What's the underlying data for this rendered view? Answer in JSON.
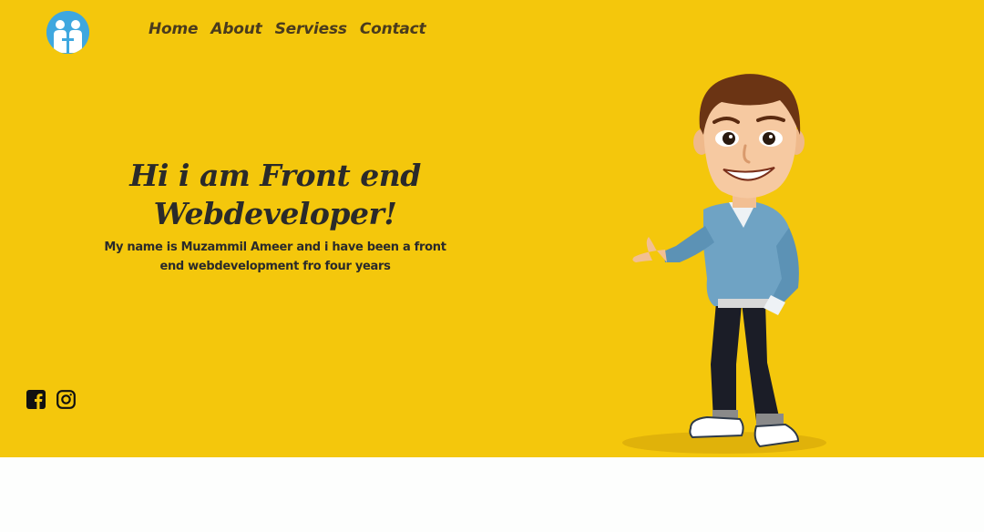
{
  "nav": {
    "items": [
      {
        "label": "Home"
      },
      {
        "label": "About"
      },
      {
        "label": "Serviess"
      },
      {
        "label": "Contact"
      }
    ]
  },
  "hero": {
    "headline": "Hi i am Front end Webdeveloper!",
    "subtext": "My name is Muzammil Ameer and i have been a front end webdevelopment fro four years"
  },
  "icons": {
    "logo": "handshake-logo",
    "social": [
      "facebook-icon",
      "instagram-icon"
    ]
  },
  "colors": {
    "hero_bg": "#f4c70c",
    "nav_text": "#4a3b1d",
    "heading_text": "#2a2a2a",
    "logo_bg": "#3ea7df",
    "page_bg": "#fdfefd"
  }
}
